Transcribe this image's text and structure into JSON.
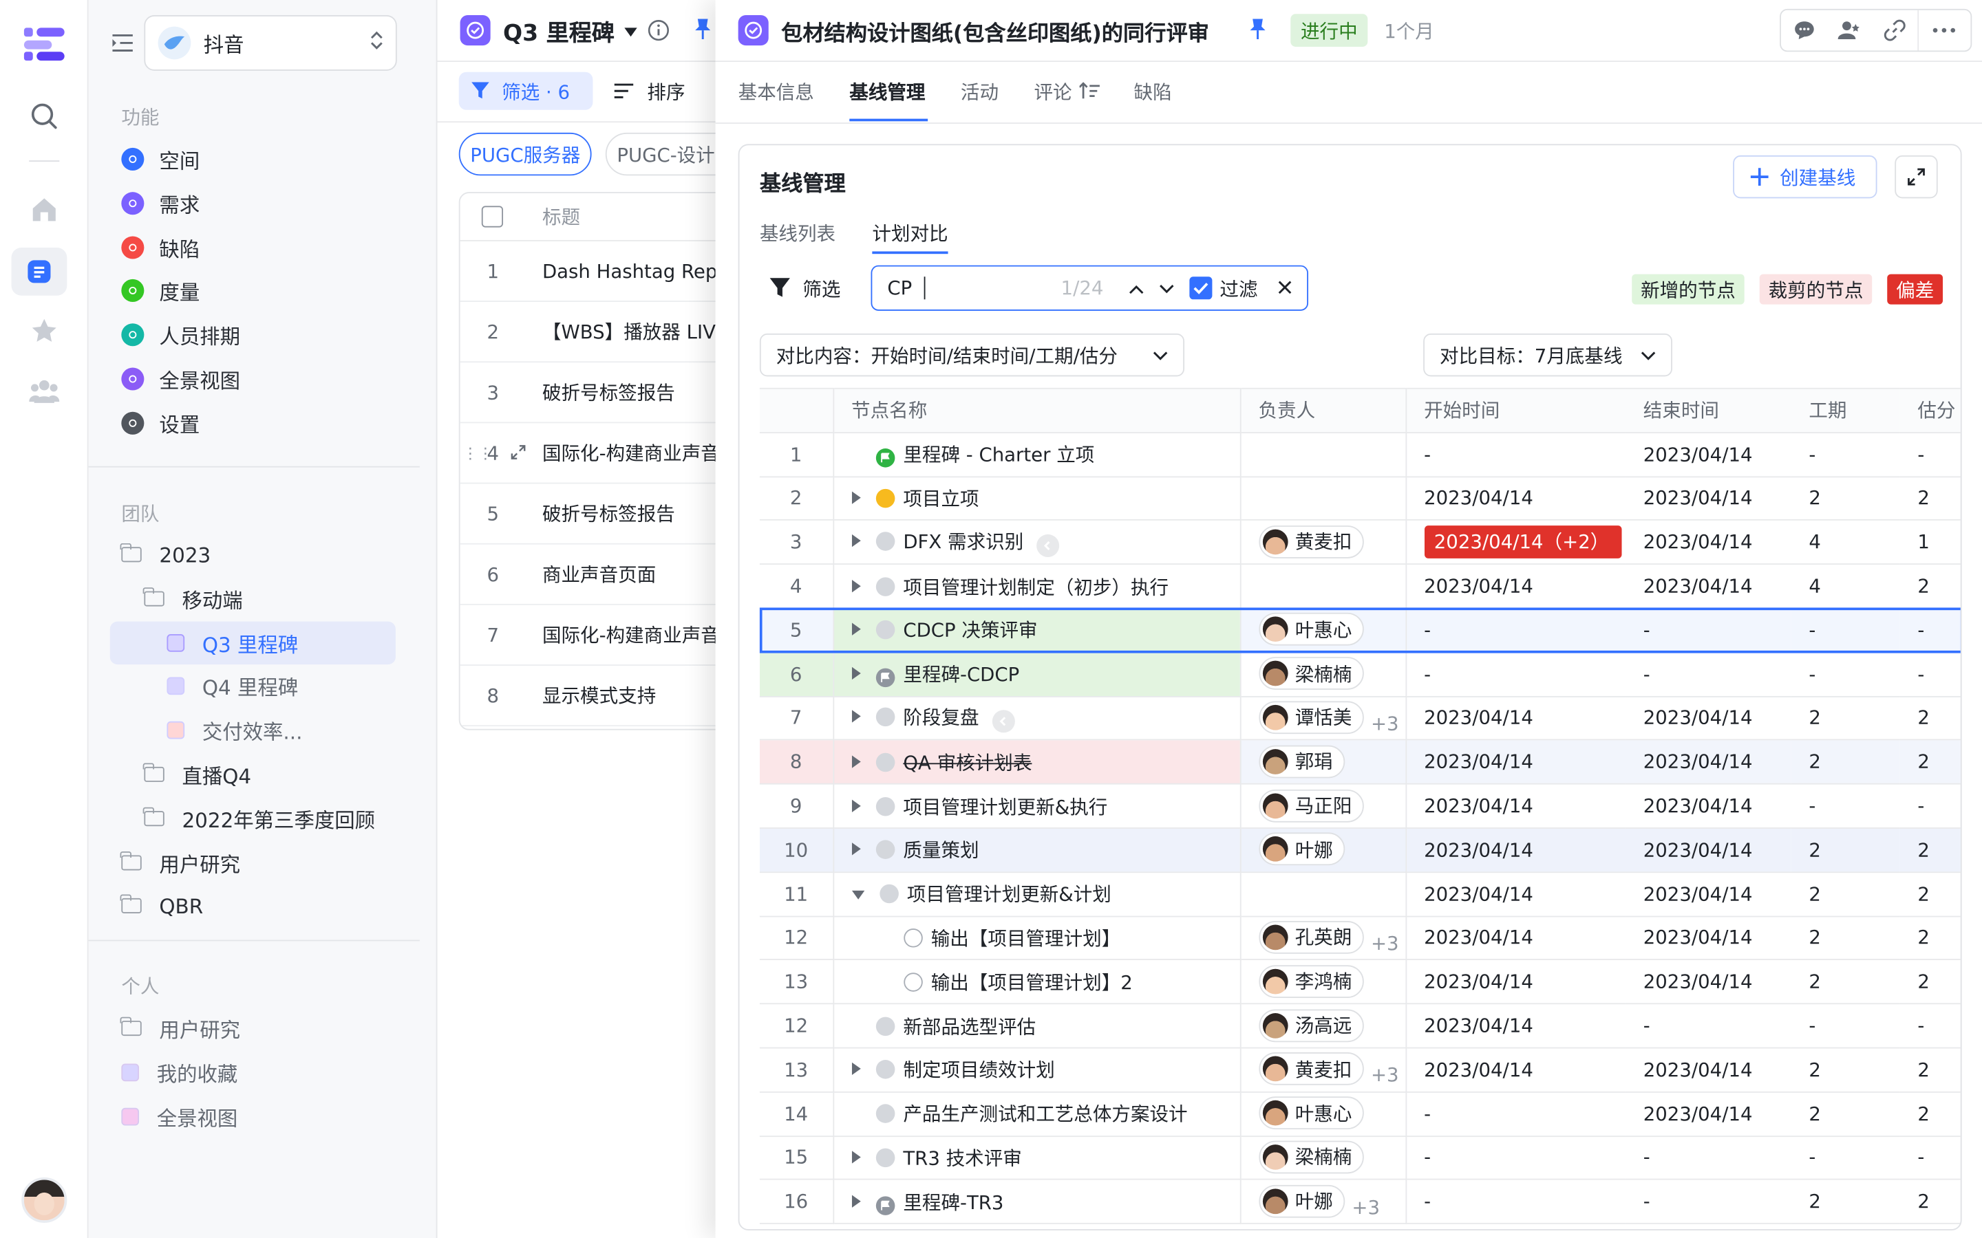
{
  "sidebar": {
    "space_name": "抖音",
    "functions_title": "功能",
    "functions": [
      {
        "label": "空间",
        "color": "#3370ff",
        "icon": "info-icon"
      },
      {
        "label": "需求",
        "color": "#7b61ff",
        "icon": "check-circle-icon"
      },
      {
        "label": "缺陷",
        "color": "#f54a45",
        "icon": "alert-icon"
      },
      {
        "label": "度量",
        "color": "#34c724",
        "icon": "gauge-icon"
      },
      {
        "label": "人员排期",
        "color": "#14b8a6",
        "icon": "calendar-icon"
      },
      {
        "label": "全景视图",
        "color": "#8b5cf6",
        "icon": "globe-icon"
      },
      {
        "label": "设置",
        "color": "#51565d",
        "icon": "settings-icon"
      }
    ],
    "team_title": "团队",
    "team_tree": [
      {
        "label": "2023",
        "type": "folder",
        "level": 0
      },
      {
        "label": "移动端",
        "type": "folder",
        "level": 1
      },
      {
        "label": "Q3 里程碑",
        "type": "view",
        "level": 2,
        "color": "#d8d4ff",
        "active": true
      },
      {
        "label": "Q4 里程碑",
        "type": "view",
        "level": 2,
        "color": "#d8d4ff"
      },
      {
        "label": "交付效率...",
        "type": "view",
        "level": 2,
        "color": "#ffd6d6"
      },
      {
        "label": "直播Q4",
        "type": "folder",
        "level": 1
      },
      {
        "label": "2022年第三季度回顾",
        "type": "folder",
        "level": 1
      },
      {
        "label": "用户研究",
        "type": "folder",
        "level": 0
      },
      {
        "label": "QBR",
        "type": "folder",
        "level": 0
      }
    ],
    "personal_title": "个人",
    "personal_tree": [
      {
        "label": "用户研究",
        "type": "folder"
      },
      {
        "label": "我的收藏",
        "type": "view",
        "color": "#d8d4ff"
      },
      {
        "label": "全景视图",
        "type": "view",
        "color": "#f6c8f0"
      }
    ]
  },
  "list": {
    "title": "Q3 里程碑",
    "filter_label": "筛选 · 6",
    "sort_label": "排序",
    "chips": [
      "PUGC服务器",
      "PUGC-设计"
    ],
    "col_title": "标题",
    "rows": [
      {
        "n": "1",
        "title": "Dash Hashtag Repo"
      },
      {
        "n": "2",
        "title": "【WBS】播放器 LIV"
      },
      {
        "n": "3",
        "title": "破折号标签报告"
      },
      {
        "n": "4",
        "title": "国际化-构建商业声音"
      },
      {
        "n": "5",
        "title": "破折号标签报告"
      },
      {
        "n": "6",
        "title": "商业声音页面"
      },
      {
        "n": "7",
        "title": "国际化-构建商业声音"
      },
      {
        "n": "8",
        "title": "显示模式支持"
      }
    ]
  },
  "detail": {
    "title": "包材结构设计图纸(包含丝印图纸)的同行评审",
    "status": "进行中",
    "duration": "1个月",
    "tabs": [
      "基本信息",
      "基线管理",
      "活动",
      "评论",
      "缺陷"
    ],
    "active_tab": 1,
    "card_title": "基线管理",
    "create_label": "创建基线",
    "subtabs": [
      "基线列表",
      "计划对比"
    ],
    "filter_label": "筛选",
    "search_value": "CP",
    "search_count": "1/24",
    "filter_toggle_label": "过滤",
    "legend": [
      {
        "label": "新增的节点",
        "bg": "#dff5dc",
        "fg": "#1f2329"
      },
      {
        "label": "裁剪的节点",
        "bg": "#fbe3e4",
        "fg": "#1f2329"
      },
      {
        "label": "偏差",
        "bg": "#e0322b",
        "fg": "#ffffff"
      }
    ],
    "compare_content": "对比内容：开始时间/结束时间/工期/估分",
    "compare_target": "对比目标：7月底基线",
    "columns": [
      "节点名称",
      "负责人",
      "开始时间",
      "结束时间",
      "工期",
      "估分"
    ],
    "rows": [
      {
        "n": "1",
        "name": "里程碑 - Charter 立项",
        "status": "flag",
        "expand": "none",
        "indent": 0,
        "owner": "",
        "extra": "",
        "start": "-",
        "end": "2023/04/14",
        "dur": "-",
        "est": "-",
        "bg": ""
      },
      {
        "n": "2",
        "name": "项目立项",
        "status": "yellow",
        "expand": "right",
        "indent": 0,
        "owner": "",
        "extra": "",
        "start": "2023/04/14",
        "end": "2023/04/14",
        "dur": "2",
        "est": "2",
        "bg": ""
      },
      {
        "n": "3",
        "name": "DFX 需求识别",
        "status": "gray",
        "expand": "right",
        "indent": 0,
        "owner": "黄麦扣",
        "extra": "",
        "start": "2023/04/14（+2）",
        "start_deviation": true,
        "end": "2023/04/14",
        "dur": "4",
        "est": "1",
        "bg": "",
        "link": true
      },
      {
        "n": "4",
        "name": "项目管理计划制定（初步）执行",
        "status": "gray",
        "expand": "right",
        "indent": 0,
        "owner": "",
        "extra": "",
        "start": "2023/04/14",
        "end": "2023/04/14",
        "dur": "4",
        "est": "2",
        "bg": ""
      },
      {
        "n": "5",
        "name": "CDCP 决策评审",
        "status": "gray",
        "expand": "right",
        "indent": 0,
        "owner": "叶惠心",
        "extra": "",
        "start": "-",
        "end": "-",
        "dur": "-",
        "est": "-",
        "bg": "added",
        "selected": true
      },
      {
        "n": "6",
        "name": "里程碑-CDCP",
        "status": "flaggray",
        "expand": "right",
        "indent": 0,
        "owner": "梁楠楠",
        "extra": "",
        "start": "-",
        "end": "-",
        "dur": "-",
        "est": "-",
        "bg": "added"
      },
      {
        "n": "7",
        "name": "阶段复盘",
        "status": "gray",
        "expand": "right",
        "indent": 0,
        "owner": "谭恬美",
        "extra": "+3",
        "start": "2023/04/14",
        "end": "2023/04/14",
        "dur": "2",
        "est": "2",
        "bg": "",
        "link": true
      },
      {
        "n": "8",
        "name": "QA 审核计划表",
        "status": "gray",
        "expand": "right",
        "indent": 0,
        "owner": "郭琄",
        "extra": "",
        "start": "2023/04/14",
        "end": "2023/04/14",
        "dur": "2",
        "est": "2",
        "bg": "removed"
      },
      {
        "n": "9",
        "name": "项目管理计划更新&执行",
        "status": "gray",
        "expand": "right",
        "indent": 0,
        "owner": "马正阳",
        "extra": "",
        "start": "2023/04/14",
        "end": "2023/04/14",
        "dur": "-",
        "est": "-",
        "bg": ""
      },
      {
        "n": "10",
        "name": "质量策划",
        "status": "gray",
        "expand": "right",
        "indent": 0,
        "owner": "叶娜",
        "extra": "",
        "start": "2023/04/14",
        "end": "2023/04/14",
        "dur": "2",
        "est": "2",
        "bg": "hover"
      },
      {
        "n": "11",
        "name": "项目管理计划更新&计划",
        "status": "gray",
        "expand": "down",
        "indent": 0,
        "owner": "",
        "extra": "",
        "start": "2023/04/14",
        "end": "2023/04/14",
        "dur": "2",
        "est": "2",
        "bg": ""
      },
      {
        "n": "12",
        "name": "输出【项目管理计划】",
        "status": "ring",
        "expand": "none",
        "indent": 1,
        "owner": "孔英朗",
        "extra": "+3",
        "start": "2023/04/14",
        "end": "2023/04/14",
        "dur": "2",
        "est": "2",
        "bg": ""
      },
      {
        "n": "13",
        "name": "输出【项目管理计划】2",
        "status": "ring",
        "expand": "none",
        "indent": 1,
        "owner": "李鸿楠",
        "extra": "",
        "start": "2023/04/14",
        "end": "2023/04/14",
        "dur": "2",
        "est": "2",
        "bg": ""
      },
      {
        "n": "12",
        "name": "新部品选型评估",
        "status": "gray",
        "expand": "none",
        "indent": 0,
        "owner": "汤高远",
        "extra": "",
        "start": "2023/04/14",
        "end": "-",
        "dur": "-",
        "est": "-",
        "bg": ""
      },
      {
        "n": "13",
        "name": "制定项目绩效计划",
        "status": "gray",
        "expand": "right",
        "indent": 0,
        "owner": "黄麦扣",
        "extra": "+3",
        "start": "2023/04/14",
        "end": "2023/04/14",
        "dur": "2",
        "est": "2",
        "bg": ""
      },
      {
        "n": "14",
        "name": "产品生产测试和工艺总体方案设计",
        "status": "gray",
        "expand": "none",
        "indent": 0,
        "owner": "叶惠心",
        "extra": "",
        "start": "-",
        "end": "2023/04/14",
        "dur": "2",
        "est": "2",
        "bg": ""
      },
      {
        "n": "15",
        "name": "TR3 技术评审",
        "status": "gray",
        "expand": "right",
        "indent": 0,
        "owner": "梁楠楠",
        "extra": "",
        "start": "-",
        "end": "-",
        "dur": "-",
        "est": "-",
        "bg": ""
      },
      {
        "n": "16",
        "name": "里程碑-TR3",
        "status": "flaggray",
        "expand": "right",
        "indent": 0,
        "owner": "叶娜",
        "extra": "+3",
        "start": "-",
        "end": "-",
        "dur": "2",
        "est": "2",
        "bg": ""
      }
    ]
  },
  "colors": {
    "accent": "#3370ff",
    "purple": "#7b61ff",
    "added_bg": "#e3f4e0",
    "removed_bg": "#fbe6e8",
    "hover_bg": "#eef2fb",
    "deviation": "#e0322b"
  }
}
